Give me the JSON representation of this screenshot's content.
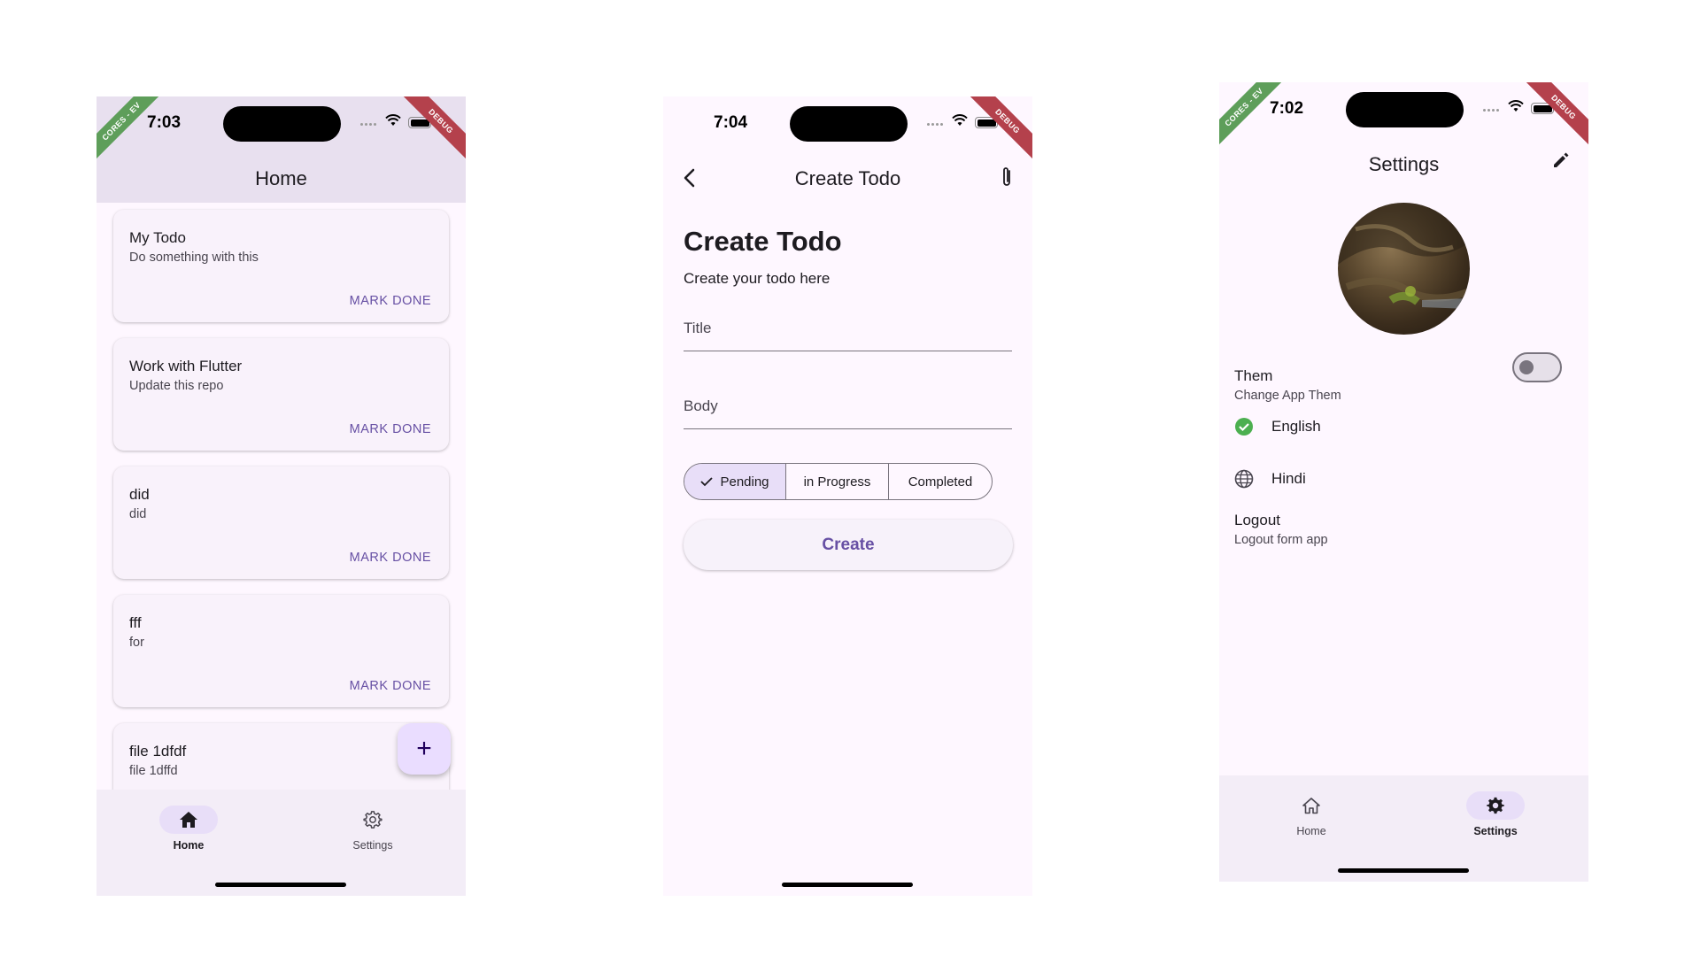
{
  "home_screen": {
    "status_time": "7:03",
    "banner_left": "CORES - EV",
    "banner_debug": "DEBUG",
    "title": "Home",
    "todos": [
      {
        "title": "My Todo",
        "body": "Do something with this",
        "action": "MARK DONE"
      },
      {
        "title": "Work with Flutter",
        "body": "Update this repo",
        "action": "MARK DONE"
      },
      {
        "title": "did",
        "body": "did",
        "action": "MARK DONE"
      },
      {
        "title": "fff",
        "body": "for",
        "action": "MARK DONE"
      },
      {
        "title": "file 1dfdf",
        "body": "file 1dffd",
        "action": ""
      }
    ],
    "fab_label": "+",
    "nav": {
      "home_label": "Home",
      "settings_label": "Settings",
      "active": "home"
    }
  },
  "create_screen": {
    "status_time": "7:04",
    "banner_debug": "DEBUG",
    "title": "Create Todo",
    "heading": "Create Todo",
    "subheading": "Create your todo here",
    "title_placeholder": "Title",
    "body_placeholder": "Body",
    "status_options": [
      "Pending",
      "in Progress",
      "Completed"
    ],
    "selected_status": "Pending",
    "create_label": "Create"
  },
  "settings_screen": {
    "status_time": "7:02",
    "banner_left": "CORES - EV",
    "banner_debug": "DEBUG",
    "title": "Settings",
    "theme_title": "Them",
    "theme_subtitle": "Change App Them",
    "theme_toggle_on": false,
    "languages": [
      {
        "label": "English",
        "selected": true
      },
      {
        "label": "Hindi",
        "selected": false
      }
    ],
    "logout_title": "Logout",
    "logout_subtitle": "Logout form app",
    "nav": {
      "home_label": "Home",
      "settings_label": "Settings",
      "active": "settings"
    }
  },
  "colors": {
    "primary": "#6750a4",
    "surface": "#fef7ff",
    "nav_background": "#f3edf7",
    "selected_pill": "#e8def8",
    "check_green": "#4caf50",
    "debug_banner": "#b4414c"
  }
}
